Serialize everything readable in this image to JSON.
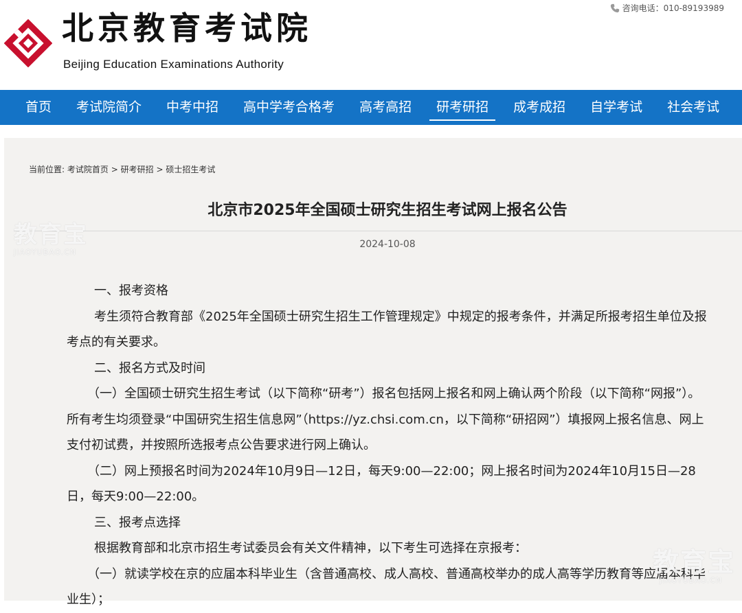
{
  "header": {
    "logo_cn": "北京教育考试院",
    "logo_en": "Beijing Education Examinations Authority",
    "hotline": "咨询电话：010-89193989",
    "colors": {
      "logo_red": "#c8102e"
    }
  },
  "nav": {
    "color": "#1473c6",
    "items": [
      {
        "label": "首页"
      },
      {
        "label": "考试院简介"
      },
      {
        "label": "中考中招"
      },
      {
        "label": "高中学考合格考"
      },
      {
        "label": "高考高招"
      },
      {
        "label": "研考研招",
        "active": true
      },
      {
        "label": "成考成招"
      },
      {
        "label": "自学考试"
      },
      {
        "label": "社会考试"
      }
    ]
  },
  "breadcrumb": {
    "prefix": "当前位置:",
    "items": [
      "考试院首页",
      "研考研招",
      "硕士招生考试"
    ],
    "separator": ">"
  },
  "article": {
    "title": "北京市2025年全国硕士研究生招生考试网上报名公告",
    "date": "2024-10-08",
    "paragraphs": [
      "一、报考资格",
      "考生须符合教育部《2025年全国硕士研究生招生工作管理规定》中规定的报考条件，并满足所报考招生单位及报考点的有关要求。",
      "二、报名方式及时间",
      "（一）全国硕士研究生招生考试（以下简称“研考”）报名包括网上报名和网上确认两个阶段（以下简称“网报”）。所有考生均须登录“中国研究生招生信息网”（https://yz.chsi.com.cn，以下简称“研招网”）填报网上报名信息、网上支付初试费，并按照所选报考点公告要求进行网上确认。",
      "（二）网上预报名时间为2024年10月9日—12日，每天9:00—22:00；网上报名时间为2024年10月15日—28日，每天9:00—22:00。",
      "三、报考点选择",
      "根据教育部和北京市招生考试委员会有关文件精神，以下考生可选择在京报考：",
      "（一）就读学校在京的应届本科毕业生（含普通高校、成人高校、普通高校举办的成人高等学历教育等应届本科毕业生）；"
    ]
  },
  "watermark": {
    "text": "教育宝",
    "sub": "JIAOYUBAO.CN"
  }
}
